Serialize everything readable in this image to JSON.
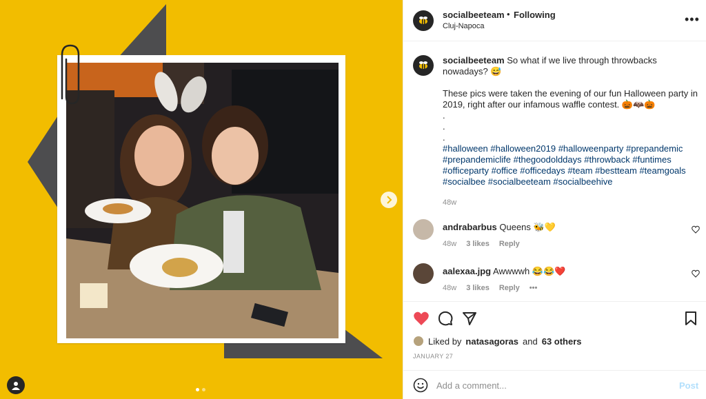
{
  "post": {
    "username": "socialbeeteam",
    "separator": "•",
    "follow_label": "Following",
    "location": "Cluj-Napoca",
    "more_label": "•••"
  },
  "caption": {
    "username": "socialbeeteam",
    "text1": "So what if we live through throwbacks nowadays? 😅",
    "text2": "These pics were taken the evening of our fun Halloween party in 2019, right after our infamous waffle contest. 🎃🦇🎃",
    "dots": [
      ".",
      ".",
      "."
    ],
    "hashtags": "#halloween #halloween2019 #halloweenparty #prepandemic #prepandemiclife #thegoodolddays #throwback #funtimes #officeparty #office #officedays #team #bestteam #teamgoals #socialbee #socialbeeteam #socialbeehive",
    "age": "48w"
  },
  "comments": [
    {
      "username": "andrabarbus",
      "text": "Queens 🐝💛",
      "age": "48w",
      "likes": "3 likes",
      "reply": "Reply",
      "more": ""
    },
    {
      "username": "aalexaa.jpg",
      "text": "Awwwwh 😂😂❤️",
      "age": "48w",
      "likes": "3 likes",
      "reply": "Reply",
      "more": "•••"
    }
  ],
  "likes": {
    "prefix": "Liked by",
    "user": "natasagoras",
    "and": "and",
    "others": "63 others"
  },
  "date": "JANUARY 27",
  "composer": {
    "placeholder": "Add a comment...",
    "post_label": "Post"
  },
  "colors": {
    "brand_yellow": "#f2bd00",
    "heart_red": "#ed4956",
    "triangle_gray": "#4d4d4f"
  },
  "icons": [
    "bee-logo-icon",
    "heart-filled-icon",
    "comment-icon",
    "share-icon",
    "bookmark-icon",
    "emoji-icon",
    "chevron-right-icon",
    "user-tag-icon",
    "paperclip-icon"
  ]
}
